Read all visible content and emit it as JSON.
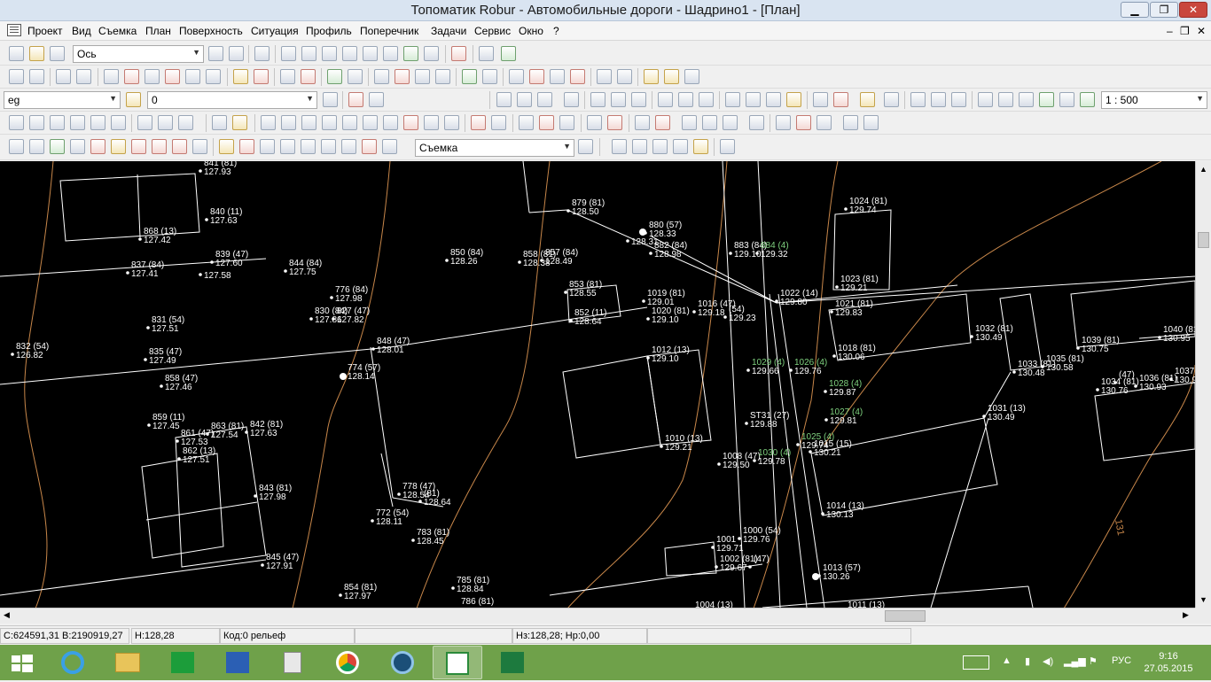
{
  "window": {
    "title": "Топоматик Robur - Автомобильные дороги - Шадрино1 - [План]",
    "minimize": "▁",
    "restore": "❐",
    "close": "✕"
  },
  "menu": {
    "items": [
      "Проект",
      "Вид",
      "Съемка",
      "План",
      "Поверхность",
      "Ситуация",
      "Профиль",
      "Поперечник",
      "Задачи",
      "Сервис",
      "Окно",
      "?"
    ],
    "mdi_min": "–",
    "mdi_restore": "❐",
    "mdi_close": "✕"
  },
  "toolbar1": {
    "combo": "Ось"
  },
  "toolbar2": {
    "layer_combo": "eg",
    "value_combo": "0",
    "scale_combo": "1 : 500"
  },
  "toolbar4": {
    "combo": "Съемка"
  },
  "status": {
    "coords": "C:624591,31 B:2190919,27",
    "height": "H:128,28",
    "code": "Код:0 рельеф",
    "design": "Нз:128,28; Нр:0,00"
  },
  "taskbar": {
    "lang": "РУС",
    "time": "9:16",
    "date": "27.05.2015"
  },
  "plan": {
    "points": [
      {
        "n": "841 (81)",
        "h": "127.93"
      },
      {
        "n": "840 (11)",
        "h": "127.63"
      },
      {
        "n": "868 (13)",
        "h": "127.42"
      },
      {
        "n": "839 (47)",
        "h": "127.60"
      },
      {
        "n": "837 (84)",
        "h": "127.41"
      },
      {
        "n": "",
        "h": "127.58"
      },
      {
        "n": "844 (84)",
        "h": "127.75"
      },
      {
        "n": "850 (84)",
        "h": "128.26"
      },
      {
        "n": "858 (81)",
        "h": "128.38"
      },
      {
        "n": "857 (84)",
        "h": "128.49"
      },
      {
        "n": "879 (81)",
        "h": "128.50"
      },
      {
        "n": "880 (57)",
        "h": "128.33"
      },
      {
        "n": "",
        "h": "128.31"
      },
      {
        "n": "882 (84)",
        "h": "128.98"
      },
      {
        "n": "883 (84)",
        "h": "129.10"
      },
      {
        "n": "884 (4)",
        "h": "129.32"
      },
      {
        "n": "1024 (81)",
        "h": "129.74"
      },
      {
        "n": "1023 (81)",
        "h": "129.21"
      },
      {
        "n": "776 (84)",
        "h": "127.98"
      },
      {
        "n": "830 (84)",
        "h": "127.86"
      },
      {
        "n": "827 (47)",
        "h": "127.82"
      },
      {
        "n": "853 (81)",
        "h": "128.55"
      },
      {
        "n": "852 (11)",
        "h": "128.64"
      },
      {
        "n": "1019 (81)",
        "h": "129.01"
      },
      {
        "n": "1020 (81)",
        "h": "129.10"
      },
      {
        "n": "1016 (47)",
        "h": "129.18"
      },
      {
        "n": "(54)",
        "h": "129.23"
      },
      {
        "n": "1022 (14)",
        "h": "129.80"
      },
      {
        "n": "1021 (81)",
        "h": "129.83"
      },
      {
        "n": "831 (54)",
        "h": "127.51"
      },
      {
        "n": "848 (47)",
        "h": "128.01"
      },
      {
        "n": "832 (54)",
        "h": "126.82"
      },
      {
        "n": "835 (47)",
        "h": "127.49"
      },
      {
        "n": "774 (57)",
        "h": "128.14"
      },
      {
        "n": "1012 (13)",
        "h": "129.10"
      },
      {
        "n": "1018 (81)",
        "h": "130.06"
      },
      {
        "n": "1032 (81)",
        "h": "130.49"
      },
      {
        "n": "1039 (81)",
        "h": "130.75"
      },
      {
        "n": "1040 (81)",
        "h": "130.95"
      },
      {
        "n": "1029 (4)",
        "h": "129.66"
      },
      {
        "n": "1026 (4)",
        "h": "129.76"
      },
      {
        "n": "1033 (81)",
        "h": "130.48"
      },
      {
        "n": "1035 (81)",
        "h": "130.58"
      },
      {
        "n": "858 (47)",
        "h": "127.46"
      },
      {
        "n": "1028 (4)",
        "h": "129.87"
      },
      {
        "n": "1034 (81)",
        "h": "130.76"
      },
      {
        "n": "1036 (81)",
        "h": "130.93"
      },
      {
        "n": "1037",
        "h": "130.90"
      },
      {
        "n": "859 (11)",
        "h": "127.45"
      },
      {
        "n": "861 (47)",
        "h": "127.53"
      },
      {
        "n": "863 (81)",
        "h": "127.54"
      },
      {
        "n": "842 (81)",
        "h": "127.63"
      },
      {
        "n": "ST31 (27)",
        "h": "129.88"
      },
      {
        "n": "1027 (4)",
        "h": "129.81"
      },
      {
        "n": "1031 (13)",
        "h": "130.49"
      },
      {
        "n": "1025 (4)",
        "h": "129.74"
      },
      {
        "n": "1015 (15)",
        "h": "130.21"
      },
      {
        "n": "862 (13)",
        "h": "127.51"
      },
      {
        "n": "1010 (13)",
        "h": "129.21"
      },
      {
        "n": "1008 (47)",
        "h": "129.50"
      },
      {
        "n": "1030 (4)",
        "h": "129.78"
      },
      {
        "n": "843 (81)",
        "h": "127.98"
      },
      {
        "n": "778 (47)",
        "h": "128.54"
      },
      {
        "n": "(81)",
        "h": "128.64"
      },
      {
        "n": "772 (54)",
        "h": "128.11"
      },
      {
        "n": "783 (81)",
        "h": "128.45"
      },
      {
        "n": "1014 (13)",
        "h": "130.13"
      },
      {
        "n": "1000 (54)",
        "h": "129.76"
      },
      {
        "n": "1001",
        "h": "129.71"
      },
      {
        "n": "845 (47)",
        "h": "127.91"
      },
      {
        "n": "1002 (81)",
        "h": "129.67"
      },
      {
        "n": "(47)",
        "h": ""
      },
      {
        "n": "1013 (57)",
        "h": "130.26"
      },
      {
        "n": "785 (81)",
        "h": "128.84"
      },
      {
        "n": "854 (81)",
        "h": "127.97"
      },
      {
        "n": "786 (81)",
        "h": ""
      },
      {
        "n": "1004 (13)",
        "h": ""
      },
      {
        "n": "1011 (13)",
        "h": ""
      },
      {
        "n": "(47)",
        "h": ""
      }
    ],
    "contour_label": "131"
  },
  "colors": {
    "canvas": "#000000",
    "lines": "#ffffff",
    "contour": "#c8874a",
    "labels_green": "#7fd27f",
    "taskbar": "#6fa14a"
  }
}
